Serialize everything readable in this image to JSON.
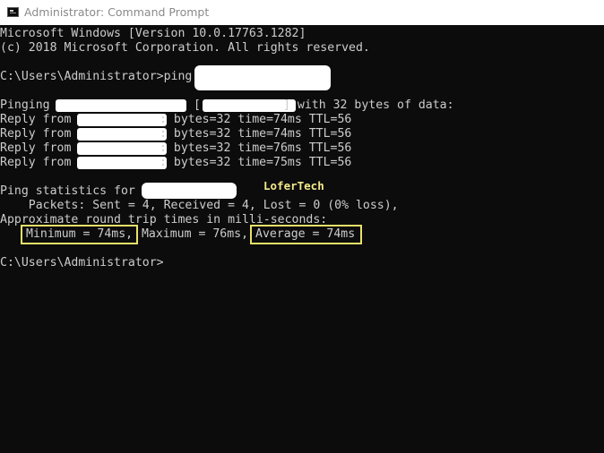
{
  "window": {
    "title": "Administrator: Command Prompt",
    "icon": "cmd-icon"
  },
  "console": {
    "header": [
      "Microsoft Windows [Version 10.0.17763.1282]",
      "(c) 2018 Microsoft Corporation. All rights reserved."
    ],
    "command_prompt": "C:\\Users\\Administrator>ping",
    "pinging_prefix": "Pinging",
    "pinging_suffix": "] with 32 bytes of data:",
    "replies": [
      {
        "prefix": "Reply from",
        "stats": ": bytes=32 time=74ms TTL=56"
      },
      {
        "prefix": "Reply from",
        "stats": ": bytes=32 time=74ms TTL=56"
      },
      {
        "prefix": "Reply from",
        "stats": ": bytes=32 time=76ms TTL=56"
      },
      {
        "prefix": "Reply from",
        "stats": ": bytes=32 time=75ms TTL=56"
      }
    ],
    "statistics_label": "Ping statistics for",
    "packets_line": "    Packets: Sent = 4, Received = 4, Lost = 0 (0% loss),",
    "approx_line": "Approximate round trip times in milli-seconds:",
    "minimum": "Minimum = 74ms,",
    "maximum": " Maximum = 76ms,",
    "average": "Average = 74ms",
    "final_prompt": "C:\\Users\\Administrator>"
  },
  "watermark": "LoferTech",
  "colors": {
    "console_bg": "#0c0c0c",
    "console_text": "#cccccc",
    "highlight_border": "#e8e06a",
    "watermark": "#f3e98a"
  }
}
